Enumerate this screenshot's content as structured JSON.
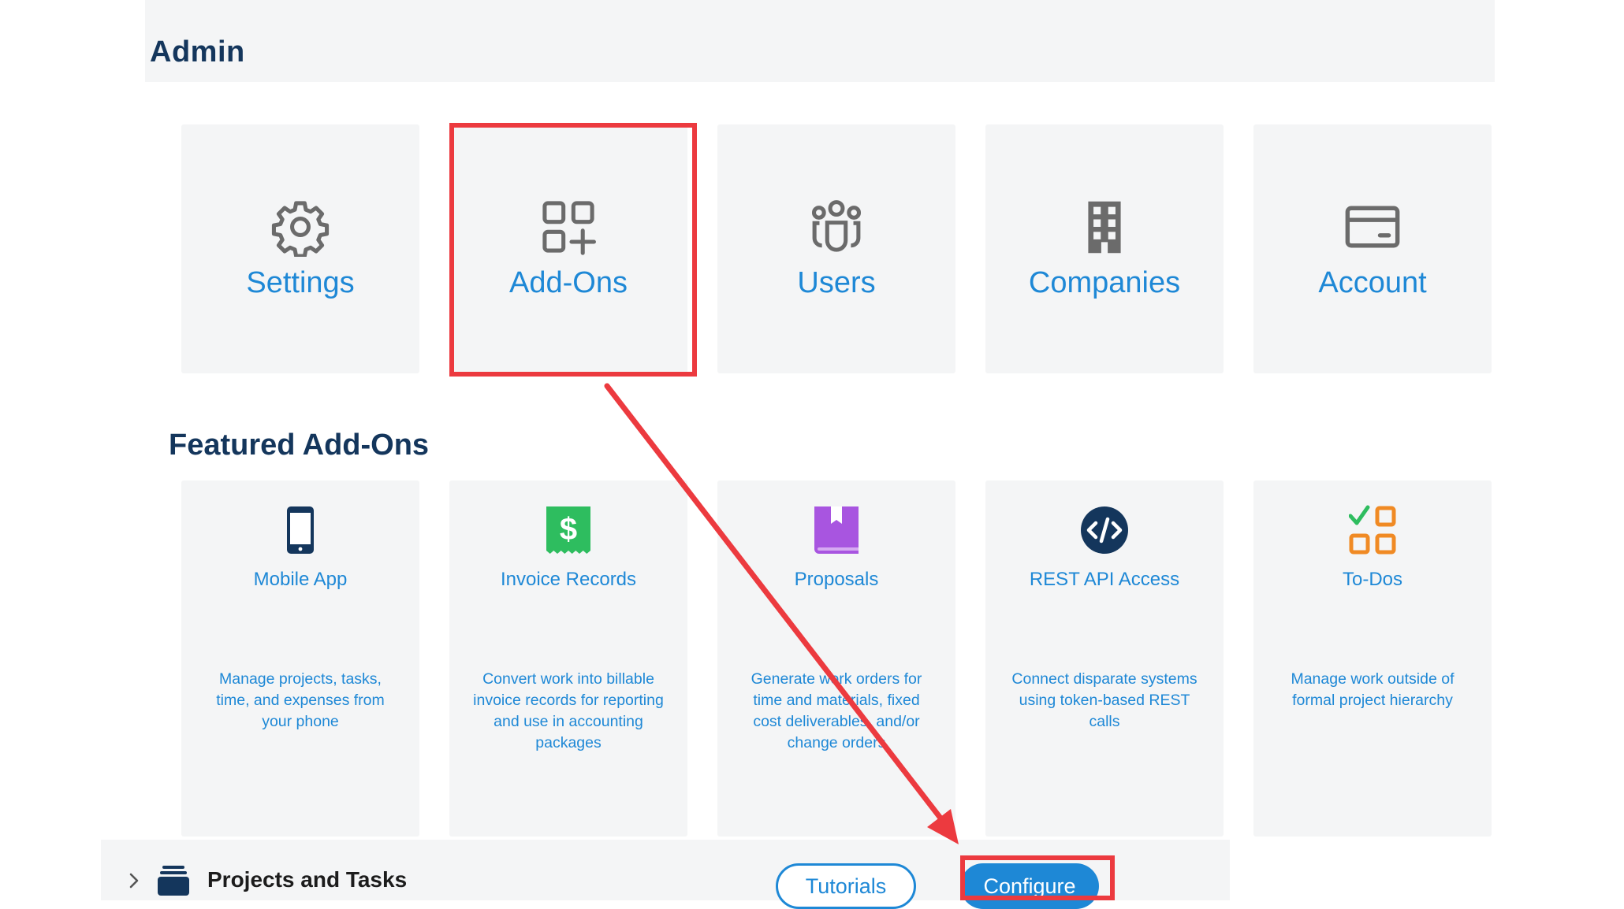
{
  "admin": {
    "title": "Admin",
    "tiles": [
      {
        "label": "Settings",
        "icon": "gear-icon"
      },
      {
        "label": "Add-Ons",
        "icon": "add-ons-grid-icon"
      },
      {
        "label": "Users",
        "icon": "users-group-icon"
      },
      {
        "label": "Companies",
        "icon": "building-icon"
      },
      {
        "label": "Account",
        "icon": "credit-card-icon"
      }
    ]
  },
  "featured": {
    "title": "Featured Add-Ons",
    "cards": [
      {
        "name": "Mobile App",
        "description": "Manage projects, tasks, time, and expenses from your phone",
        "icon": "mobile-phone-icon",
        "color": "#14365c"
      },
      {
        "name": "Invoice Records",
        "description": "Convert work into billable invoice records for reporting and use in accounting packages",
        "icon": "dollar-receipt-icon",
        "color": "#2ebd5f"
      },
      {
        "name": "Proposals",
        "description": "Generate work orders for time and materials, fixed cost deliverables, and/or change orders",
        "icon": "bookmark-book-icon",
        "color": "#a855e0"
      },
      {
        "name": "REST API Access",
        "description": "Connect disparate systems using token-based REST calls",
        "icon": "code-icon",
        "color": "#14365c"
      },
      {
        "name": "To-Dos",
        "description": "Manage work outside of formal project hierarchy",
        "icon": "checklist-grid-icon",
        "color": "#f08a24"
      }
    ]
  },
  "bottom_bar": {
    "section_label": "Projects and Tasks",
    "tutorials_label": "Tutorials",
    "configure_label": "Configure"
  },
  "colors": {
    "accent": "#1e88d6",
    "title": "#14365c",
    "tile_bg": "#f4f5f6",
    "icon_gray": "#6b6b6b",
    "highlight": "#ec3a3f"
  }
}
